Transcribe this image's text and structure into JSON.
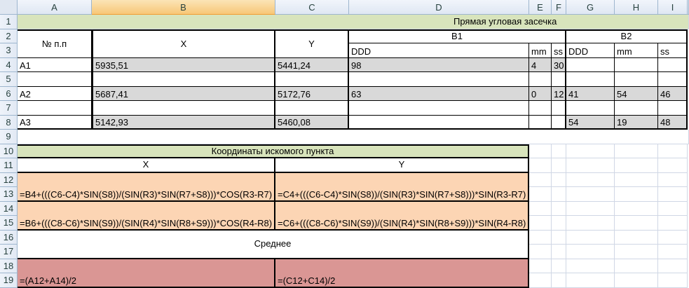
{
  "columns": [
    "A",
    "B",
    "C",
    "D",
    "E",
    "F",
    "G",
    "H",
    "I"
  ],
  "rows": [
    "1",
    "2",
    "3",
    "4",
    "5",
    "6",
    "7",
    "8",
    "9",
    "10",
    "11",
    "12",
    "13",
    "14",
    "15",
    "16",
    "17",
    "18",
    "19"
  ],
  "title": "Прямая угловая засечка",
  "headers": {
    "num": "№ п.п",
    "x": "X",
    "y": "Y",
    "b1": "B1",
    "b2": "B2",
    "ddd": "DDD",
    "mm": "mm",
    "ss": "ss"
  },
  "points": [
    {
      "name": "A1",
      "x": "5935,51",
      "y": "5441,24",
      "b1_ddd": "98",
      "b1_mm": "4",
      "b1_ss": "30",
      "b2_ddd": "",
      "b2_mm": "",
      "b2_ss": ""
    },
    {
      "name": "A2",
      "x": "5687,41",
      "y": "5172,76",
      "b1_ddd": "63",
      "b1_mm": "0",
      "b1_ss": "12",
      "b2_ddd": "41",
      "b2_mm": "54",
      "b2_ss": "46"
    },
    {
      "name": "A3",
      "x": "5142,93",
      "y": "5460,08",
      "b1_ddd": "",
      "b1_mm": "",
      "b1_ss": "",
      "b2_ddd": "54",
      "b2_mm": "19",
      "b2_ss": "48"
    }
  ],
  "result": {
    "title": "Координаты искомого пункта",
    "x_label": "X",
    "y_label": "Y",
    "x1": "=B4+(((C6-C4)*SIN(S8))/(SIN(R3)*SIN(R7+S8)))*COS(R3-R7)",
    "y1": "=C4+(((C6-C4)*SIN(S8))/(SIN(R3)*SIN(R7+S8)))*SIN(R3-R7)",
    "x2": "=B6+(((C8-C6)*SIN(S9))/(SIN(R4)*SIN(R8+S9)))*COS(R4-R8)",
    "y2": "=C6+(((C8-C6)*SIN(S9))/(SIN(R4)*SIN(R8+S9)))*SIN(R4-R8)",
    "avg_label": "Среднее",
    "x_avg": "=(A12+A14)/2",
    "y_avg": "=(C12+C14)/2"
  }
}
